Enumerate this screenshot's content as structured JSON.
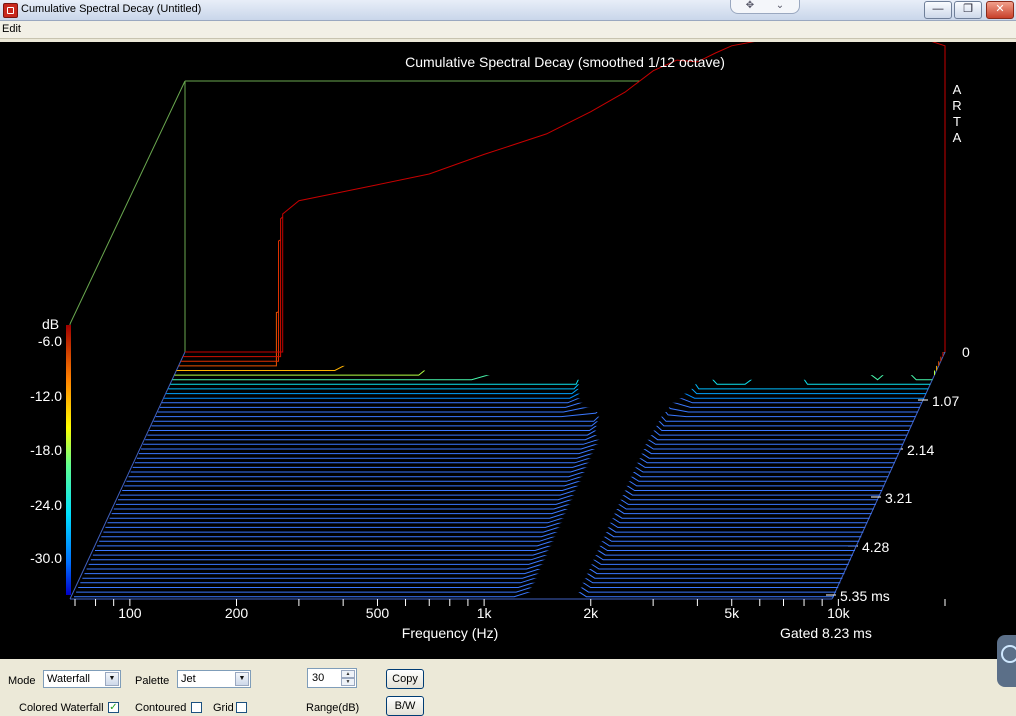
{
  "window": {
    "title": "Cumulative Spectral Decay  (Untitled)",
    "minimize_glyph": "—",
    "restore_glyph": "❐",
    "close_glyph": "✕"
  },
  "menu": {
    "edit_label": "Edit"
  },
  "chart_data": {
    "type": "waterfall",
    "title": "Cumulative Spectral Decay (smoothed 1/12 octave)",
    "watermark": "ARTA",
    "xlabel": "Frequency (Hz)",
    "x_scale": "log",
    "x_ticks": [
      "100",
      "200",
      "500",
      "1k",
      "2k",
      "5k",
      "10k"
    ],
    "x_tick_values": [
      100,
      200,
      500,
      1000,
      2000,
      5000,
      10000
    ],
    "xlim": [
      70,
      20000
    ],
    "ylabel": "dB",
    "ylim": [
      -30,
      0
    ],
    "y_ticks": [
      "-6.0",
      "-12.0",
      "-18.0",
      "-24.0",
      "-30.0"
    ],
    "y_tick_values": [
      -6,
      -12,
      -18,
      -24,
      -30
    ],
    "z_label_top": "0",
    "z_ticks": [
      "1.07",
      "2.14",
      "3.21",
      "4.28",
      "5.35 ms"
    ],
    "z_tick_values": [
      1.07,
      2.14,
      3.21,
      4.28,
      5.35
    ],
    "gated_label": "Gated 8.23 ms",
    "palette": "Jet",
    "slice_count": 54,
    "slice_spacing_ms": 0.1,
    "curve_frequencies": [
      270,
      300,
      400,
      500,
      700,
      1000,
      1500,
      2000,
      2500,
      3000,
      3500,
      4000,
      4500,
      5000,
      6000,
      7000,
      8000,
      9000,
      10000,
      12000,
      14000,
      16000,
      18000,
      20000
    ],
    "slices": [
      {
        "time_ms": 0.0,
        "db": [
          -14.5,
          -13.0,
          -12.0,
          -11.2,
          -10.0,
          -7.8,
          -5.5,
          -3.0,
          -0.8,
          1.6,
          2.8,
          2.6,
          3.6,
          4.4,
          5.0,
          5.4,
          5.8,
          6.2,
          6.8,
          6.6,
          6.2,
          5.8,
          5.0,
          4.4
        ]
      },
      {
        "time_ms": 0.1,
        "db": [
          -14.5,
          -13.0,
          -12.0,
          -11.2,
          -10.0,
          -7.8,
          -5.8,
          -3.4,
          -1.4,
          0.8,
          2.2,
          1.8,
          2.8,
          3.6,
          4.4,
          4.8,
          5.0,
          5.4,
          6.0,
          5.8,
          5.4,
          5.0,
          4.2,
          3.6
        ]
      },
      {
        "time_ms": 0.2,
        "db": [
          -16.5,
          -15.5,
          -14.5,
          -13.5,
          -12.0,
          -9.5,
          -7.5,
          -5.0,
          -3.6,
          -1.5,
          0.0,
          -0.6,
          0.6,
          1.6,
          2.4,
          3.0,
          3.4,
          3.8,
          4.2,
          4.0,
          3.6,
          3.0,
          2.4,
          1.8
        ]
      },
      {
        "time_ms": 0.3,
        "db": [
          -24.0,
          -23.5,
          -22.0,
          -20.0,
          -17.0,
          -13.5,
          -10.5,
          -7.5,
          -6.0,
          -3.5,
          -2.0,
          -3.0,
          -1.8,
          -0.5,
          0.4,
          1.0,
          1.6,
          2.0,
          1.8,
          2.2,
          1.6,
          1.0,
          0.4,
          -0.6
        ]
      },
      {
        "time_ms": 0.4,
        "db": [
          -30.0,
          -30.0,
          -30.0,
          -28.0,
          -22.0,
          -17.0,
          -14.0,
          -11.0,
          -8.5,
          -6.0,
          -5.0,
          -6.5,
          -5.5,
          -4.0,
          -7.5,
          -5.0,
          -3.0,
          -6.0,
          -4.0,
          -4.5,
          -5.5,
          -4.0,
          -6.0,
          -6.5
        ]
      },
      {
        "time_ms": 0.5,
        "db": [
          -30.0,
          -30.0,
          -30.0,
          -30.0,
          -30.0,
          -25.0,
          -20.0,
          -16.0,
          -12.5,
          -9.5,
          -10.0,
          -12.0,
          -14.0,
          -16.0,
          -18.5,
          -13.0,
          -11.0,
          -18.0,
          -14.5,
          -16.0,
          -19.0,
          -14.0,
          -20.0,
          -22.0
        ]
      },
      {
        "time_ms": 0.6,
        "db": [
          -30.0,
          -30.0,
          -30.0,
          -30.0,
          -30.0,
          -30.0,
          -28.0,
          -24.0,
          -18.0,
          -14.0,
          -15.5,
          -20.0,
          -22.0,
          -27.0,
          -29.0,
          -24.0,
          -22.0,
          -29.0,
          -26.0,
          -28.0,
          -30.0,
          -28.0,
          -30.0,
          -30.0
        ]
      },
      {
        "time_ms": 0.7,
        "db": [
          -30.0,
          -30.0,
          -30.0,
          -30.0,
          -30.0,
          -30.0,
          -30.0,
          -30.0,
          -22.0,
          -18.0,
          -19.5,
          -24.0,
          -28.0,
          -30.0,
          -30.0,
          -28.0,
          -27.0,
          -30.0,
          -30.0,
          -30.0,
          -30.0,
          -30.0,
          -30.0,
          -30.0
        ]
      },
      {
        "time_ms": 0.8,
        "db": [
          -30.0,
          -30.0,
          -30.0,
          -30.0,
          -30.0,
          -30.0,
          -30.0,
          -30.0,
          -26.0,
          -21.0,
          -22.0,
          -27.0,
          -30.0,
          -30.0,
          -30.0,
          -30.0,
          -30.0,
          -30.0,
          -30.0,
          -30.0,
          -30.0,
          -30.0,
          -30.0,
          -30.0
        ]
      },
      {
        "time_ms": 1.0,
        "db": [
          -30.0,
          -30.0,
          -30.0,
          -30.0,
          -30.0,
          -30.0,
          -30.0,
          -30.0,
          -28.0,
          -24.0,
          -24.5,
          -29.0,
          -30.0,
          -30.0,
          -30.0,
          -30.0,
          -30.0,
          -30.0,
          -30.0,
          -30.0,
          -30.0,
          -30.0,
          -30.0,
          -30.0
        ]
      },
      {
        "time_ms": 1.5,
        "db": [
          -30.0,
          -30.0,
          -30.0,
          -30.0,
          -30.0,
          -30.0,
          -30.0,
          -30.0,
          -30.0,
          -27.0,
          -27.5,
          -30.0,
          -30.0,
          -30.0,
          -30.0,
          -30.0,
          -30.0,
          -30.0,
          -30.0,
          -30.0,
          -30.0,
          -30.0,
          -30.0,
          -30.0
        ]
      },
      {
        "time_ms": 2.0,
        "db": [
          -30.0,
          -30.0,
          -30.0,
          -30.0,
          -30.0,
          -30.0,
          -30.0,
          -30.0,
          -30.0,
          -29.0,
          -28.5,
          -30.0,
          -30.0,
          -30.0,
          -30.0,
          -30.0,
          -30.0,
          -30.0,
          -30.0,
          -30.0,
          -30.0,
          -30.0,
          -30.0,
          -30.0
        ]
      }
    ]
  },
  "controls": {
    "mode_label": "Mode",
    "mode_value": "Waterfall",
    "palette_label": "Palette",
    "palette_value": "Jet",
    "range_value": "30",
    "range_label": "Range(dB)",
    "copy_label": "Copy",
    "bw_label": "B/W",
    "colored_waterfall_label": "Colored Waterfall",
    "colored_waterfall_checked": true,
    "contoured_label": "Contoured",
    "contoured_checked": false,
    "grid_label": "Grid",
    "grid_checked": false
  }
}
